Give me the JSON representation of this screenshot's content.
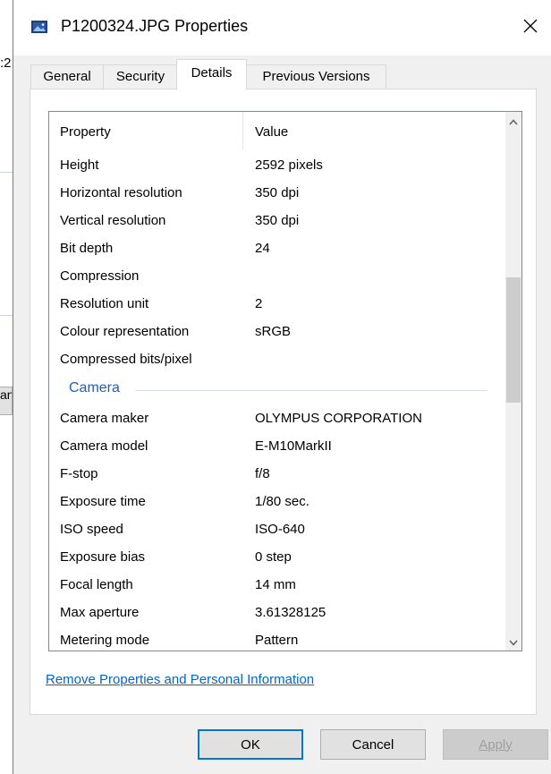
{
  "background": {
    "fragments": [
      ":2",
      "an"
    ]
  },
  "dialog": {
    "title": "P1200324.JPG Properties",
    "close_label": "✕"
  },
  "tabs": [
    {
      "label": "General"
    },
    {
      "label": "Security"
    },
    {
      "label": "Details",
      "active": true
    },
    {
      "label": "Previous Versions"
    }
  ],
  "list": {
    "header": {
      "property": "Property",
      "value": "Value"
    },
    "rows_image": [
      {
        "property": "Height",
        "value": "2592 pixels"
      },
      {
        "property": "Horizontal resolution",
        "value": "350 dpi"
      },
      {
        "property": "Vertical resolution",
        "value": "350 dpi"
      },
      {
        "property": "Bit depth",
        "value": "24"
      },
      {
        "property": "Compression",
        "value": ""
      },
      {
        "property": "Resolution unit",
        "value": "2"
      },
      {
        "property": "Colour representation",
        "value": "sRGB"
      },
      {
        "property": "Compressed bits/pixel",
        "value": ""
      }
    ],
    "group_camera": "Camera",
    "rows_camera": [
      {
        "property": "Camera maker",
        "value": "OLYMPUS CORPORATION"
      },
      {
        "property": "Camera model",
        "value": "E-M10MarkII"
      },
      {
        "property": "F-stop",
        "value": "f/8"
      },
      {
        "property": "Exposure time",
        "value": "1/80 sec."
      },
      {
        "property": "ISO speed",
        "value": "ISO-640"
      },
      {
        "property": "Exposure bias",
        "value": "0 step"
      },
      {
        "property": "Focal length",
        "value": "14 mm"
      },
      {
        "property": "Max aperture",
        "value": "3.61328125"
      },
      {
        "property": "Metering mode",
        "value": "Pattern"
      }
    ]
  },
  "remove_link": "Remove Properties and Personal Information",
  "buttons": {
    "ok": "OK",
    "cancel": "Cancel",
    "apply": "Apply"
  },
  "colors": {
    "accent": "#0078d7",
    "link": "#0066cc",
    "group_heading": "#1e5ebc"
  },
  "icons": {
    "title": "image-file-icon",
    "close": "close-icon",
    "scroll_up": "chevron-up-icon",
    "scroll_down": "chevron-down-icon"
  }
}
